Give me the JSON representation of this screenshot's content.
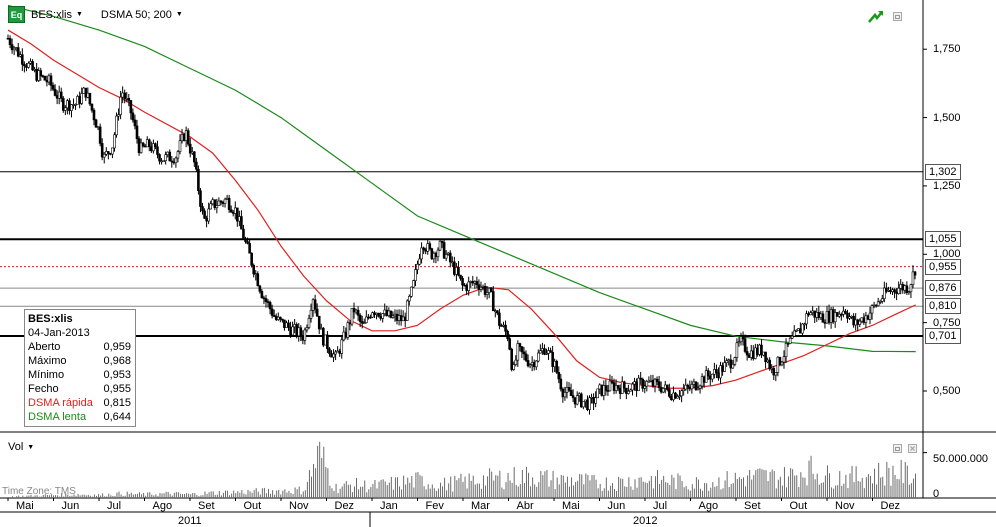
{
  "header": {
    "symbol": "BES:xlis",
    "indicator": "DSMA 50; 200"
  },
  "info": {
    "title": "BES:xlis",
    "date": "04-Jan-2013",
    "rows": [
      {
        "label": "Aberto",
        "value": "0,959",
        "color": "#000000"
      },
      {
        "label": "Máximo",
        "value": "0,968",
        "color": "#000000"
      },
      {
        "label": "Mínimo",
        "value": "0,953",
        "color": "#000000"
      },
      {
        "label": "Fecho",
        "value": "0,955",
        "color": "#000000"
      },
      {
        "label": "DSMA rápida",
        "value": "0,815",
        "color": "#e02020"
      },
      {
        "label": "DSMA lenta",
        "value": "0,644",
        "color": "#1a8a1a"
      }
    ]
  },
  "volume": {
    "label": "Vol",
    "tick": "50.000.000",
    "zero": "0",
    "timezone": "Time Zone: TMS"
  },
  "colors": {
    "price": "#000000",
    "fast": "#e02020",
    "slow": "#1a8a1a",
    "grid": "#a8a8a8",
    "volume": "#6a6a6a"
  },
  "chart_data": {
    "type": "candlestick",
    "title": "BES:xlis",
    "y_ticks": [
      "1,750",
      "1,500",
      "1,250",
      "1,000",
      "0,750",
      "0,500"
    ],
    "y_tick_values": [
      1.75,
      1.5,
      1.25,
      1.0,
      0.75,
      0.5
    ],
    "ylim": [
      0.35,
      1.93
    ],
    "months": [
      "Mai",
      "Jun",
      "Jul",
      "Ago",
      "Set",
      "Out",
      "Nov",
      "Dez",
      "Jan",
      "Fev",
      "Mar",
      "Abr",
      "Mai",
      "Jun",
      "Jul",
      "Ago",
      "Set",
      "Out",
      "Nov",
      "Dez"
    ],
    "years": [
      "2011",
      "2012"
    ],
    "horizontal_lines": [
      {
        "label": "1,302",
        "value": 1.302,
        "style": "solid"
      },
      {
        "label": "1,055",
        "value": 1.055,
        "style": "bold"
      },
      {
        "label": "0,955",
        "value": 0.955,
        "style": "dotted-red"
      },
      {
        "label": "0,876",
        "value": 0.876,
        "style": "solid-gray"
      },
      {
        "label": "0,810",
        "value": 0.81,
        "style": "solid-gray"
      },
      {
        "label": "0,701",
        "value": 0.701,
        "style": "bold"
      }
    ],
    "price_series": [
      {
        "m": 0.0,
        "v": 1.79
      },
      {
        "m": 0.3,
        "v": 1.72
      },
      {
        "m": 0.6,
        "v": 1.66
      },
      {
        "m": 0.9,
        "v": 1.63
      },
      {
        "m": 1.2,
        "v": 1.55
      },
      {
        "m": 1.5,
        "v": 1.55
      },
      {
        "m": 1.7,
        "v": 1.6
      },
      {
        "m": 2.0,
        "v": 1.45
      },
      {
        "m": 2.1,
        "v": 1.35
      },
      {
        "m": 2.3,
        "v": 1.4
      },
      {
        "m": 2.5,
        "v": 1.6
      },
      {
        "m": 2.7,
        "v": 1.52
      },
      {
        "m": 2.9,
        "v": 1.38
      },
      {
        "m": 3.1,
        "v": 1.4
      },
      {
        "m": 3.4,
        "v": 1.35
      },
      {
        "m": 3.7,
        "v": 1.36
      },
      {
        "m": 3.9,
        "v": 1.45
      },
      {
        "m": 4.1,
        "v": 1.33
      },
      {
        "m": 4.3,
        "v": 1.12
      },
      {
        "m": 4.5,
        "v": 1.18
      },
      {
        "m": 4.8,
        "v": 1.2
      },
      {
        "m": 5.0,
        "v": 1.16
      },
      {
        "m": 5.2,
        "v": 1.05
      },
      {
        "m": 5.4,
        "v": 0.95
      },
      {
        "m": 5.6,
        "v": 0.85
      },
      {
        "m": 5.9,
        "v": 0.76
      },
      {
        "m": 6.2,
        "v": 0.73
      },
      {
        "m": 6.5,
        "v": 0.7
      },
      {
        "m": 6.7,
        "v": 0.85
      },
      {
        "m": 6.9,
        "v": 0.7
      },
      {
        "m": 7.2,
        "v": 0.62
      },
      {
        "m": 7.4,
        "v": 0.7
      },
      {
        "m": 7.6,
        "v": 0.8
      },
      {
        "m": 7.8,
        "v": 0.73
      },
      {
        "m": 8.0,
        "v": 0.8
      },
      {
        "m": 8.4,
        "v": 0.77
      },
      {
        "m": 8.7,
        "v": 0.76
      },
      {
        "m": 8.9,
        "v": 0.88
      },
      {
        "m": 9.1,
        "v": 1.05
      },
      {
        "m": 9.3,
        "v": 1.0
      },
      {
        "m": 9.5,
        "v": 1.03
      },
      {
        "m": 9.8,
        "v": 0.95
      },
      {
        "m": 10.0,
        "v": 0.88
      },
      {
        "m": 10.3,
        "v": 0.9
      },
      {
        "m": 10.6,
        "v": 0.85
      },
      {
        "m": 10.8,
        "v": 0.75
      },
      {
        "m": 11.0,
        "v": 0.7
      },
      {
        "m": 11.1,
        "v": 0.56
      },
      {
        "m": 11.2,
        "v": 0.65
      },
      {
        "m": 11.5,
        "v": 0.6
      },
      {
        "m": 11.8,
        "v": 0.66
      },
      {
        "m": 12.0,
        "v": 0.6
      },
      {
        "m": 12.2,
        "v": 0.5
      },
      {
        "m": 12.5,
        "v": 0.47
      },
      {
        "m": 12.8,
        "v": 0.45
      },
      {
        "m": 13.0,
        "v": 0.5
      },
      {
        "m": 13.3,
        "v": 0.52
      },
      {
        "m": 13.6,
        "v": 0.51
      },
      {
        "m": 14.0,
        "v": 0.53
      },
      {
        "m": 14.3,
        "v": 0.52
      },
      {
        "m": 14.6,
        "v": 0.49
      },
      {
        "m": 15.0,
        "v": 0.51
      },
      {
        "m": 15.3,
        "v": 0.55
      },
      {
        "m": 15.6,
        "v": 0.57
      },
      {
        "m": 15.9,
        "v": 0.61
      },
      {
        "m": 16.1,
        "v": 0.68
      },
      {
        "m": 16.3,
        "v": 0.64
      },
      {
        "m": 16.6,
        "v": 0.65
      },
      {
        "m": 16.8,
        "v": 0.57
      },
      {
        "m": 17.0,
        "v": 0.62
      },
      {
        "m": 17.2,
        "v": 0.68
      },
      {
        "m": 17.4,
        "v": 0.72
      },
      {
        "m": 17.6,
        "v": 0.79
      },
      {
        "m": 17.9,
        "v": 0.77
      },
      {
        "m": 18.2,
        "v": 0.78
      },
      {
        "m": 18.4,
        "v": 0.8
      },
      {
        "m": 18.6,
        "v": 0.74
      },
      {
        "m": 18.9,
        "v": 0.78
      },
      {
        "m": 19.1,
        "v": 0.82
      },
      {
        "m": 19.3,
        "v": 0.86
      },
      {
        "m": 19.6,
        "v": 0.88
      },
      {
        "m": 19.8,
        "v": 0.88
      },
      {
        "m": 19.95,
        "v": 0.955
      }
    ],
    "fast_ma": [
      {
        "m": 0.0,
        "v": 1.82
      },
      {
        "m": 0.5,
        "v": 1.77
      },
      {
        "m": 1.0,
        "v": 1.71
      },
      {
        "m": 2.0,
        "v": 1.61
      },
      {
        "m": 2.5,
        "v": 1.57
      },
      {
        "m": 3.0,
        "v": 1.52
      },
      {
        "m": 4.0,
        "v": 1.43
      },
      {
        "m": 4.5,
        "v": 1.37
      },
      {
        "m": 5.0,
        "v": 1.27
      },
      {
        "m": 5.5,
        "v": 1.16
      },
      {
        "m": 6.0,
        "v": 1.03
      },
      {
        "m": 6.5,
        "v": 0.92
      },
      {
        "m": 7.0,
        "v": 0.83
      },
      {
        "m": 7.5,
        "v": 0.76
      },
      {
        "m": 8.0,
        "v": 0.72
      },
      {
        "m": 8.5,
        "v": 0.72
      },
      {
        "m": 9.0,
        "v": 0.74
      },
      {
        "m": 9.5,
        "v": 0.8
      },
      {
        "m": 10.0,
        "v": 0.85
      },
      {
        "m": 10.5,
        "v": 0.88
      },
      {
        "m": 11.0,
        "v": 0.87
      },
      {
        "m": 11.5,
        "v": 0.8
      },
      {
        "m": 12.0,
        "v": 0.71
      },
      {
        "m": 12.5,
        "v": 0.61
      },
      {
        "m": 13.0,
        "v": 0.55
      },
      {
        "m": 13.5,
        "v": 0.53
      },
      {
        "m": 14.0,
        "v": 0.52
      },
      {
        "m": 14.5,
        "v": 0.51
      },
      {
        "m": 15.0,
        "v": 0.51
      },
      {
        "m": 15.5,
        "v": 0.52
      },
      {
        "m": 16.0,
        "v": 0.54
      },
      {
        "m": 16.5,
        "v": 0.57
      },
      {
        "m": 17.0,
        "v": 0.6
      },
      {
        "m": 17.5,
        "v": 0.63
      },
      {
        "m": 18.0,
        "v": 0.67
      },
      {
        "m": 18.5,
        "v": 0.71
      },
      {
        "m": 19.0,
        "v": 0.74
      },
      {
        "m": 19.5,
        "v": 0.78
      },
      {
        "m": 19.95,
        "v": 0.815
      }
    ],
    "slow_ma": [
      {
        "m": 0.0,
        "v": 1.91
      },
      {
        "m": 1.0,
        "v": 1.87
      },
      {
        "m": 2.0,
        "v": 1.82
      },
      {
        "m": 3.0,
        "v": 1.76
      },
      {
        "m": 4.0,
        "v": 1.68
      },
      {
        "m": 5.0,
        "v": 1.6
      },
      {
        "m": 6.0,
        "v": 1.5
      },
      {
        "m": 7.0,
        "v": 1.38
      },
      {
        "m": 8.0,
        "v": 1.26
      },
      {
        "m": 9.0,
        "v": 1.14
      },
      {
        "m": 10.0,
        "v": 1.07
      },
      {
        "m": 11.0,
        "v": 1.0
      },
      {
        "m": 12.0,
        "v": 0.93
      },
      {
        "m": 13.0,
        "v": 0.86
      },
      {
        "m": 14.0,
        "v": 0.8
      },
      {
        "m": 15.0,
        "v": 0.74
      },
      {
        "m": 16.0,
        "v": 0.7
      },
      {
        "m": 17.0,
        "v": 0.68
      },
      {
        "m": 18.0,
        "v": 0.665
      },
      {
        "m": 19.0,
        "v": 0.645
      },
      {
        "m": 19.95,
        "v": 0.644
      }
    ],
    "volume_ylim": [
      0,
      65000000
    ],
    "volume": [
      {
        "m": 0.5,
        "v": 3000000
      },
      {
        "m": 1.0,
        "v": 4000000
      },
      {
        "m": 1.5,
        "v": 5000000
      },
      {
        "m": 2.0,
        "v": 4000000
      },
      {
        "m": 2.5,
        "v": 6000000
      },
      {
        "m": 3.0,
        "v": 5000000
      },
      {
        "m": 3.5,
        "v": 6000000
      },
      {
        "m": 4.0,
        "v": 5000000
      },
      {
        "m": 4.5,
        "v": 7000000
      },
      {
        "m": 5.0,
        "v": 8000000
      },
      {
        "m": 5.5,
        "v": 9000000
      },
      {
        "m": 6.0,
        "v": 10000000
      },
      {
        "m": 6.5,
        "v": 11000000
      },
      {
        "m": 6.85,
        "v": 62000000
      },
      {
        "m": 7.2,
        "v": 14000000
      },
      {
        "m": 7.6,
        "v": 18000000
      },
      {
        "m": 8.0,
        "v": 16000000
      },
      {
        "m": 8.5,
        "v": 20000000
      },
      {
        "m": 9.0,
        "v": 24000000
      },
      {
        "m": 9.5,
        "v": 18000000
      },
      {
        "m": 10.0,
        "v": 22000000
      },
      {
        "m": 10.5,
        "v": 26000000
      },
      {
        "m": 11.0,
        "v": 28000000
      },
      {
        "m": 11.5,
        "v": 30000000
      },
      {
        "m": 12.0,
        "v": 25000000
      },
      {
        "m": 12.5,
        "v": 24000000
      },
      {
        "m": 13.0,
        "v": 20000000
      },
      {
        "m": 13.5,
        "v": 22000000
      },
      {
        "m": 14.0,
        "v": 26000000
      },
      {
        "m": 14.5,
        "v": 24000000
      },
      {
        "m": 15.0,
        "v": 20000000
      },
      {
        "m": 15.5,
        "v": 22000000
      },
      {
        "m": 16.0,
        "v": 26000000
      },
      {
        "m": 16.5,
        "v": 30000000
      },
      {
        "m": 17.0,
        "v": 28000000
      },
      {
        "m": 17.3,
        "v": 32000000
      },
      {
        "m": 17.6,
        "v": 40000000
      },
      {
        "m": 18.0,
        "v": 30000000
      },
      {
        "m": 18.5,
        "v": 28000000
      },
      {
        "m": 19.0,
        "v": 32000000
      },
      {
        "m": 19.5,
        "v": 36000000
      },
      {
        "m": 19.9,
        "v": 30000000
      }
    ]
  }
}
